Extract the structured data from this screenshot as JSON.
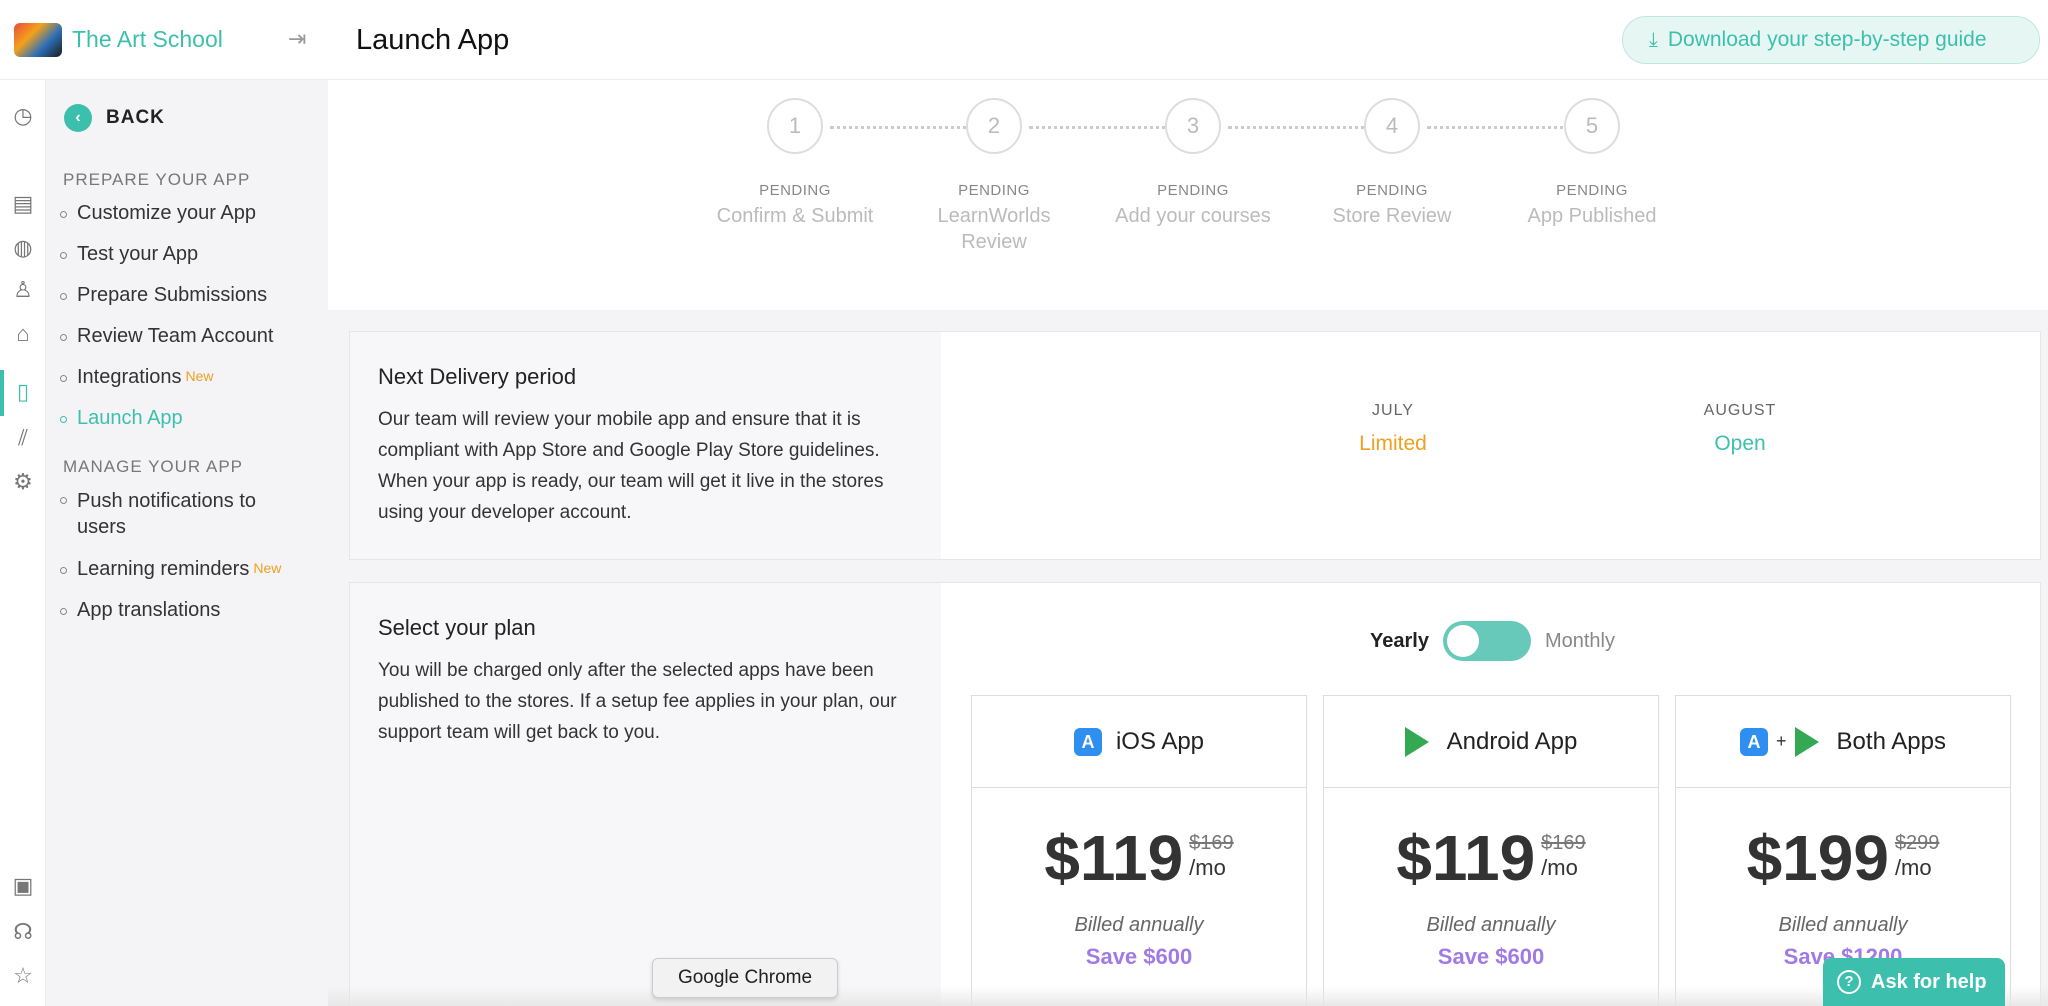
{
  "brand": {
    "name": "The Art School"
  },
  "header": {
    "title": "Launch App",
    "download_label": "Download your step-by-step guide"
  },
  "subnav": {
    "back_label": "BACK",
    "prepare_title": "PREPARE YOUR APP",
    "manage_title": "MANAGE YOUR APP",
    "prepare_items": [
      {
        "label": "Customize your App"
      },
      {
        "label": "Test your App"
      },
      {
        "label": "Prepare Submissions"
      },
      {
        "label": "Review Team Account"
      },
      {
        "label": "Integrations",
        "badge": "New"
      },
      {
        "label": "Launch App"
      }
    ],
    "manage_items": [
      {
        "label": "Push notifications to users"
      },
      {
        "label": "Learning reminders",
        "badge": "New"
      },
      {
        "label": "App translations"
      }
    ]
  },
  "steps": [
    {
      "num": "1",
      "status": "PENDING",
      "label": "Confirm & Submit"
    },
    {
      "num": "2",
      "status": "PENDING",
      "label": "LearnWorlds Review"
    },
    {
      "num": "3",
      "status": "PENDING",
      "label": "Add your courses"
    },
    {
      "num": "4",
      "status": "PENDING",
      "label": "Store Review"
    },
    {
      "num": "5",
      "status": "PENDING",
      "label": "App Published"
    }
  ],
  "delivery": {
    "title": "Next Delivery period",
    "description": "Our team will review your mobile app and ensure that it is compliant with App Store and Google Play Store guidelines. When your app is ready, our team will get it live in the stores using your developer account.",
    "months": [
      {
        "name": "JULY",
        "value": "Limited",
        "color": "#f0a020"
      },
      {
        "name": "AUGUST",
        "value": "Open",
        "color": "#3dbfae"
      }
    ]
  },
  "plans": {
    "title": "Select your plan",
    "description": "You will be charged only after the selected apps have been published to the stores. If a setup fee applies in your plan, our support team will get back to you.",
    "toggle": {
      "left": "Yearly",
      "right": "Monthly"
    },
    "items": [
      {
        "name": "iOS App",
        "price": "$119",
        "old_price": "$169",
        "unit": "/mo",
        "billed": "Billed annually",
        "save": "Save $600"
      },
      {
        "name": "Android App",
        "price": "$119",
        "old_price": "$169",
        "unit": "/mo",
        "billed": "Billed annually",
        "save": "Save $600"
      },
      {
        "name": "Both Apps",
        "plus": "+",
        "price": "$199",
        "old_price": "$299",
        "unit": "/mo",
        "billed": "Billed annually",
        "save": "Save $1200"
      }
    ]
  },
  "tooltip": "Google Chrome",
  "help": {
    "label": "Ask for help"
  },
  "colors": {
    "accent": "#3dbfae",
    "limited": "#f0a020",
    "save": "#a17ae6",
    "new_badge": "#f0a020"
  }
}
